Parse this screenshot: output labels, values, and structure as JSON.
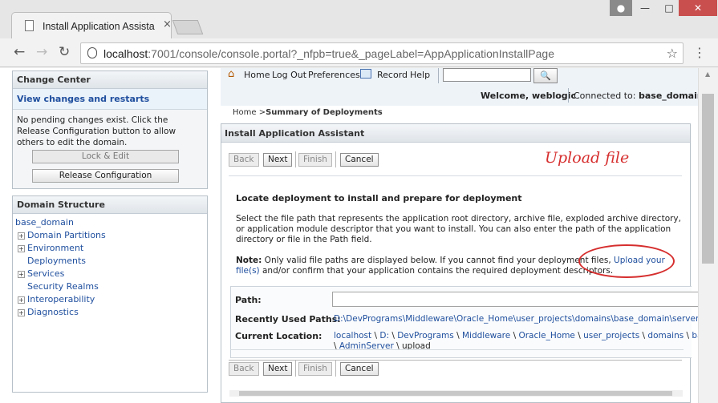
{
  "browser": {
    "tab_title": "Install Application Assista",
    "tab_close": "×",
    "url_host": "localhost",
    "url_rest": ":7001/console/console.portal?_nfpb=true&_pageLabel=AppApplicationInstallPage",
    "icons": [
      "back-arrow-icon",
      "forward-arrow-icon",
      "reload-icon",
      "lock-icon",
      "star-icon",
      "menu-icon",
      "user-icon",
      "minimize-icon",
      "maximize-icon",
      "close-icon"
    ]
  },
  "change_center": {
    "title": "Change Center",
    "link": "View changes and restarts",
    "text": "No pending changes exist. Click the Release Configuration button to allow others to edit the domain.",
    "lock_button": "Lock & Edit",
    "release_button": "Release Configuration"
  },
  "domain_structure": {
    "title": "Domain Structure",
    "root": "base_domain",
    "items": [
      {
        "label": "Domain Partitions",
        "expandable": true
      },
      {
        "label": "Environment",
        "expandable": true
      },
      {
        "label": "Deployments",
        "expandable": false
      },
      {
        "label": "Services",
        "expandable": true
      },
      {
        "label": "Security Realms",
        "expandable": false
      },
      {
        "label": "Interoperability",
        "expandable": true
      },
      {
        "label": "Diagnostics",
        "expandable": true
      }
    ]
  },
  "header": {
    "home": "Home",
    "logout": "Log Out",
    "preferences": "Preferences",
    "record": "Record",
    "help": "Help",
    "welcome": "Welcome, weblogic",
    "connected_label": "Connected to:",
    "connected_domain": "base_domain"
  },
  "breadcrumb": {
    "home": "Home",
    "sep": " >",
    "current": "Summary of Deployments"
  },
  "assistant": {
    "title": "Install Application Assistant",
    "buttons": {
      "back": "Back",
      "next": "Next",
      "finish": "Finish",
      "cancel": "Cancel"
    },
    "annotation": "Upload file",
    "section_title": "Locate deployment to install and prepare for deployment",
    "description": "Select the file path that represents the application root directory, archive file, exploded archive directory, or application module descriptor that you want to install. You can also enter the path of the application directory or file in the Path field.",
    "note_label": "Note:",
    "note_text": " Only valid file paths are displayed below. If you cannot find your deployment files, ",
    "note_link": "Upload your file(s)",
    "note_text2": " and/or confirm that your application contains the required deployment descriptors.",
    "path_label": "Path:",
    "path_value": "",
    "recent_label": "Recently Used Paths:",
    "recent_value": "D:\\DevPrograms\\Middleware\\Oracle_Home\\user_projects\\domains\\base_domain\\servers",
    "current_label": "Current Location:",
    "current_parts": [
      "localhost",
      "D:",
      "DevPrograms",
      "Middleware",
      "Oracle_Home",
      "user_projects",
      "domains",
      "bas"
    ],
    "current_line2_link": "AdminServer",
    "current_line2_plain": "upload"
  }
}
